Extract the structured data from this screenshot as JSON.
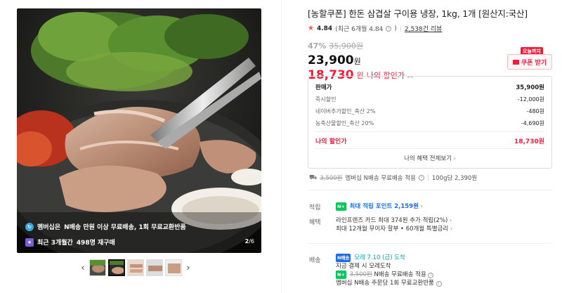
{
  "gallery": {
    "overlay_1_prefix": "멤버십은",
    "overlay_1_text": "N배송 만원 이상 무료배송, 1회 무료교환반품",
    "overlay_2_prefix": "최근 3개월간",
    "overlay_2_text": "498명 재구매",
    "counter_current": "2",
    "counter_total": "/6",
    "prev_icon": "chevron-left-icon",
    "next_icon": "chevron-right-icon"
  },
  "product": {
    "title": "[농할쿠폰] 한돈 삼겹살 구이용 냉장, 1kg, 1개 [원산지:국산]",
    "rating": "4.84",
    "rating_detail": "(최근 6개월 4.84",
    "review_count": "2,538건 리뷰",
    "discount_pct": "47%",
    "original_price": "35,900원",
    "price": "23,900",
    "price_unit": "원",
    "my_price": "18,730",
    "my_price_unit": "원",
    "my_price_label": "나의 할인가"
  },
  "coupon": {
    "tag": "오늘까지",
    "label": "쿠폰 받기"
  },
  "breakdown": {
    "rows": [
      {
        "label": "판매가",
        "value": "35,900원"
      },
      {
        "label": "즉시할인",
        "value": "-12,000원"
      },
      {
        "label": "네이버추가할인_축산 2%",
        "value": "-480원"
      },
      {
        "label": "농축산물할인_축산 20%",
        "value": "-4,690원"
      }
    ],
    "mine_label": "나의 할인가",
    "mine_value": "18,730원",
    "view_all": "나의 혜택 전체보기"
  },
  "shipping": {
    "strike_fee": "3,500원",
    "text": "멤버십 N배송 무료배송 적용",
    "unit_price": "100g당 2,390원"
  },
  "points": {
    "label": "적립",
    "badge": "N+",
    "text": "최대 적립 포인트 2,159원"
  },
  "benefit": {
    "label": "혜택",
    "line1": "라인프렌즈 카드 최대 374원 추가 적립(2%)",
    "line2": "최대 12개월 무이자 할부 • 60개월 특별금리"
  },
  "delivery": {
    "label": "배송",
    "badge": "N배송",
    "arrival": "모레 7.10 (금) 도착",
    "line2": "지금 결제 시 모레도착",
    "badge2": "N+",
    "strike_fee": "3,500원",
    "line3": "N배송 무료배송 적용",
    "line4": "멤버십 N배송 주문당 1회 무료교환반품"
  },
  "colors": {
    "accent_red": "#f21c3a",
    "npay_green": "#03c75a",
    "blue": "#1e6de5"
  }
}
